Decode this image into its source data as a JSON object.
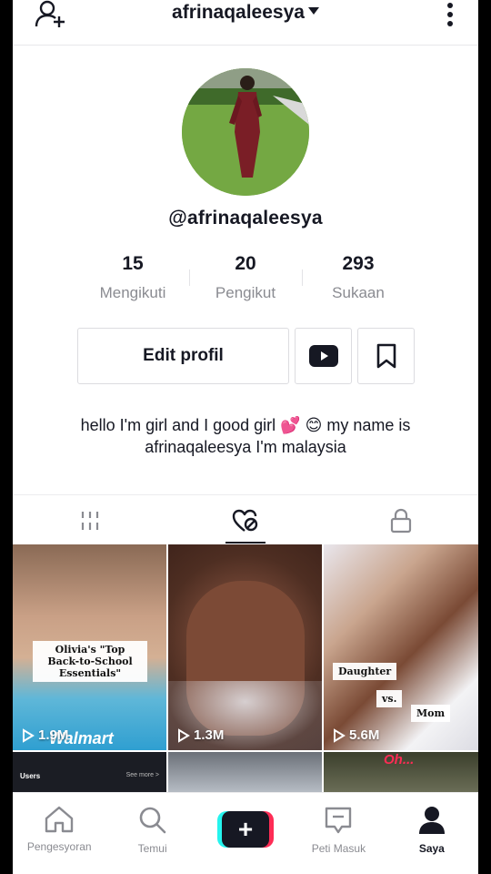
{
  "header": {
    "account_handle": "afrinaqaleesya",
    "add_user_icon": "add-user-icon",
    "more_icon": "more-vertical-icon"
  },
  "profile": {
    "username": "@afrinaqaleesya",
    "stats": [
      {
        "value": "15",
        "label": "Mengikuti"
      },
      {
        "value": "20",
        "label": "Pengikut"
      },
      {
        "value": "293",
        "label": "Sukaan"
      }
    ],
    "edit_label": "Edit profil",
    "bio_line1": "hello I'm girl and I good girl 💕 😊 my name is",
    "bio_line2": "afrinaqaleesya I'm malaysia"
  },
  "tabs": [
    {
      "icon": "grid-icon",
      "active": false
    },
    {
      "icon": "liked-heart-icon",
      "active": true
    },
    {
      "icon": "lock-icon",
      "active": false
    }
  ],
  "videos": [
    {
      "views": "1.9M",
      "caption": "Olivia's \"Top Back-to-School Essentials\"",
      "brand": "Walmart"
    },
    {
      "views": "1.3M"
    },
    {
      "views": "5.6M",
      "caption_a": "Daughter",
      "caption_b": "vs.",
      "caption_c": "Mom"
    },
    {
      "label_a": "Users",
      "label_b": "See more >"
    },
    {},
    {
      "label_a": "Oh..."
    }
  ],
  "bottom_nav": [
    {
      "label": "Pengesyoran",
      "icon": "home-icon"
    },
    {
      "label": "Temui",
      "icon": "search-icon"
    },
    {
      "label": "",
      "icon": "create-plus-icon"
    },
    {
      "label": "Peti Masuk",
      "icon": "inbox-icon"
    },
    {
      "label": "Saya",
      "icon": "profile-icon",
      "active": true
    }
  ],
  "colors": {
    "accent_red": "#fe2c55",
    "accent_cyan": "#25f4ee",
    "text": "#161823",
    "muted": "#8a8b91"
  }
}
